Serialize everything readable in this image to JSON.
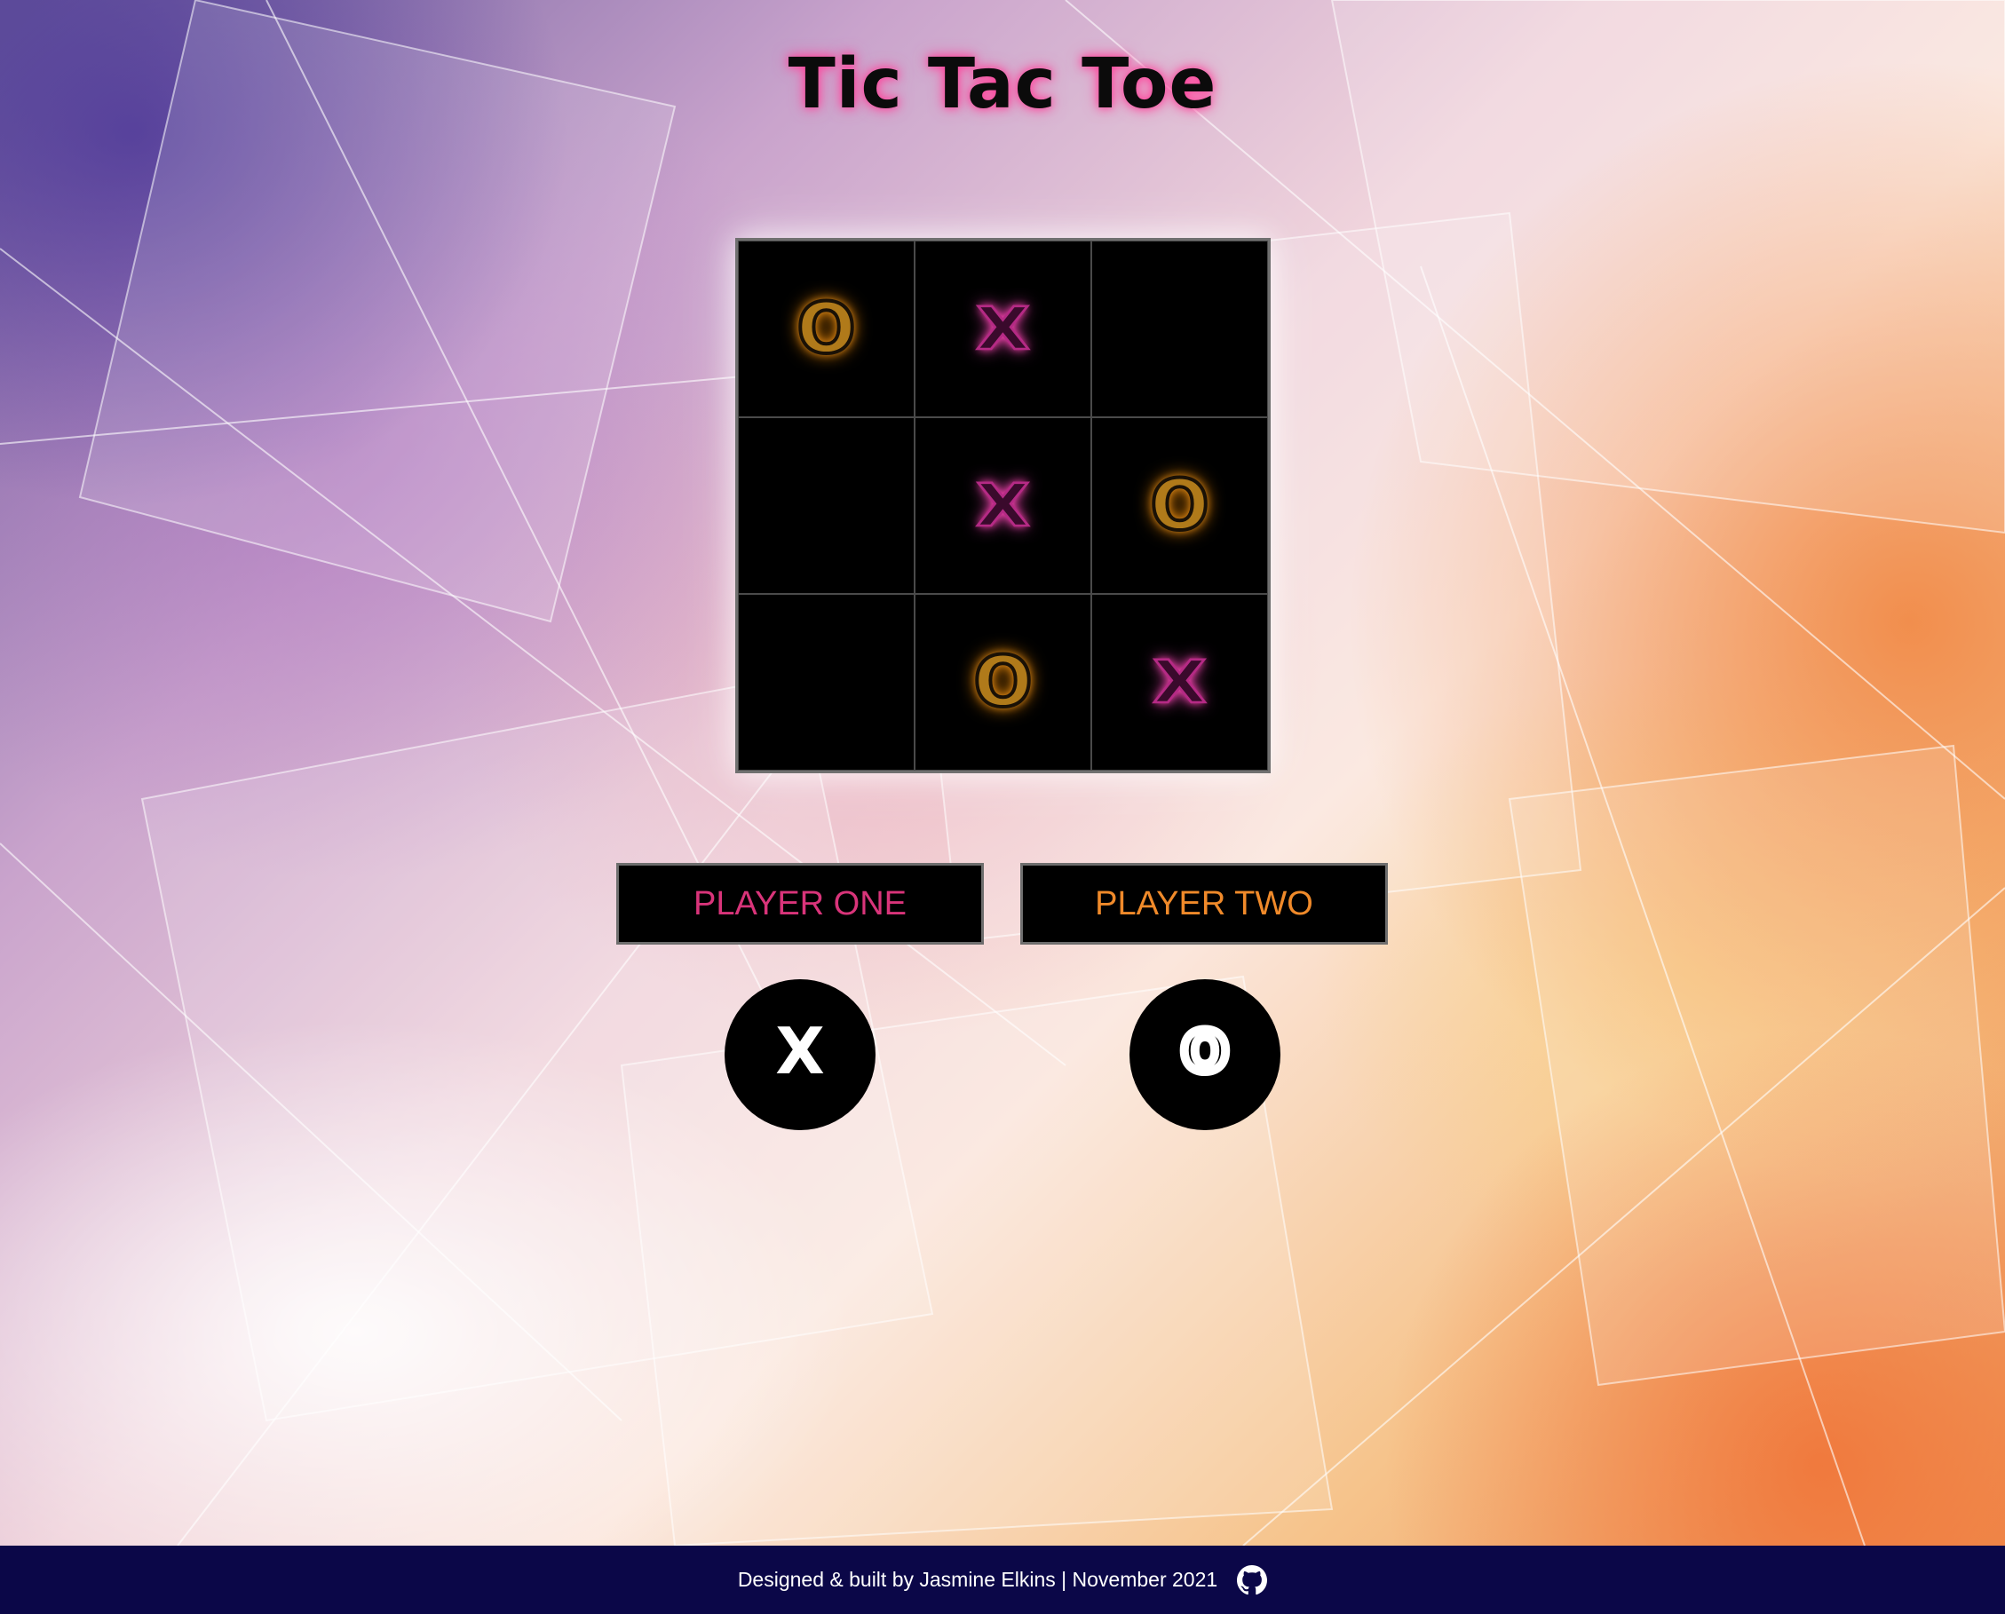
{
  "title": "Tic Tac Toe",
  "board": {
    "cells": [
      "O",
      "X",
      "",
      "",
      "X",
      "O",
      "",
      "O",
      "X"
    ]
  },
  "players": {
    "one": {
      "label": "PLAYER ONE",
      "symbol": "X",
      "color": "#d9347a"
    },
    "two": {
      "label": "PLAYER TWO",
      "symbol": "O",
      "color": "#f08a2a"
    }
  },
  "footer": {
    "text": "Designed & built by Jasmine Elkins | November 2021",
    "icon": "github-icon"
  },
  "colors": {
    "x_glow": "#ff3fb0",
    "o_glow": "#ffa020",
    "footer_bg": "#0b0748"
  }
}
